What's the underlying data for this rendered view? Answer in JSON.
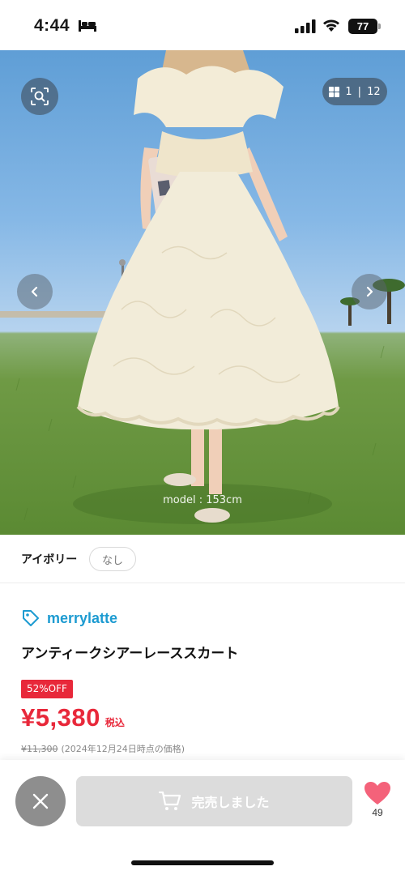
{
  "status_bar": {
    "time": "4:44",
    "battery": "77",
    "icons": [
      "bed-icon",
      "signal-icon",
      "wifi-icon",
      "battery-icon"
    ]
  },
  "gallery": {
    "counter_current": "1",
    "counter_separator": "|",
    "counter_total": "12",
    "model_caption": "model : 153cm",
    "icons": [
      "zoom-search-icon",
      "grid-icon",
      "chevron-left-icon",
      "chevron-right-icon"
    ]
  },
  "variant": {
    "color": "アイボリー",
    "option": "なし"
  },
  "product": {
    "brand": "merrylatte",
    "title": "アンティークシアーレーススカート",
    "discount": "52%OFF",
    "price": "¥5,380",
    "tax_label": "税込",
    "original_price": "¥11,300",
    "price_note": "(2024年12月24日時点の価格)"
  },
  "actions": {
    "soldout_label": "完売しました",
    "favorite_count": "49",
    "icons": [
      "close-icon",
      "cart-icon",
      "heart-icon"
    ]
  },
  "colors": {
    "accent_red": "#e8283a",
    "brand_blue": "#1d9bd1",
    "heart_pink": "#f4627a",
    "disabled_gray": "#dcdcdc"
  }
}
